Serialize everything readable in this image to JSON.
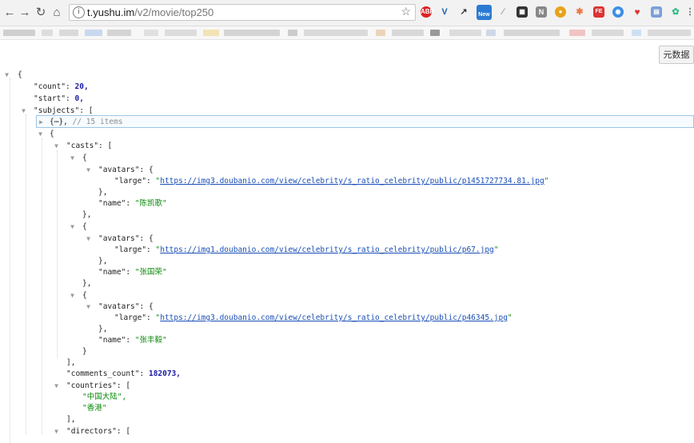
{
  "browser": {
    "url_host": "t.yushu.im",
    "url_path": "/v2/movie/top250",
    "new_badge": "New"
  },
  "viewer": {
    "meta_button": "元数据"
  },
  "json": {
    "open": "{",
    "count_key": "\"count\":",
    "count_value": "20,",
    "start_key": "\"start\":",
    "start_value": "0,",
    "subjects_key": "\"subjects\":",
    "subjects_open": "[",
    "collapsed_obj": "{⋯},",
    "collapsed_comment": "// 15 items",
    "subject_open": "{",
    "casts_key": "\"casts\":",
    "casts_open": "[",
    "casts": [
      {
        "obj_open": "{",
        "avatars_key": "\"avatars\":",
        "avatars_open": "{",
        "large_key": "\"large\":",
        "large_url": "https://img3.doubanio.com/view/celebrity/s_ratio_celebrity/public/p1451727734.81.jpg",
        "avatars_close": "},",
        "name_key": "\"name\":",
        "name_value": "\"陈凯歌\"",
        "obj_close": "},"
      },
      {
        "obj_open": "{",
        "avatars_key": "\"avatars\":",
        "avatars_open": "{",
        "large_key": "\"large\":",
        "large_url": "https://img1.doubanio.com/view/celebrity/s_ratio_celebrity/public/p67.jpg",
        "avatars_close": "},",
        "name_key": "\"name\":",
        "name_value": "\"张国荣\"",
        "obj_close": "},"
      },
      {
        "obj_open": "{",
        "avatars_key": "\"avatars\":",
        "avatars_open": "{",
        "large_key": "\"large\":",
        "large_url": "https://img3.doubanio.com/view/celebrity/s_ratio_celebrity/public/p46345.jpg",
        "avatars_close": "},",
        "name_key": "\"name\":",
        "name_value": "\"张丰毅\"",
        "obj_close": "}"
      }
    ],
    "casts_close": "],",
    "comments_count_key": "\"comments_count\":",
    "comments_count_value": "182073,",
    "countries_key": "\"countries\":",
    "countries_open": "[",
    "country_1": "\"中国大陆\",",
    "country_2": "\"香港\"",
    "countries_close": "],",
    "directors_key": "\"directors\":",
    "directors_open": "["
  }
}
